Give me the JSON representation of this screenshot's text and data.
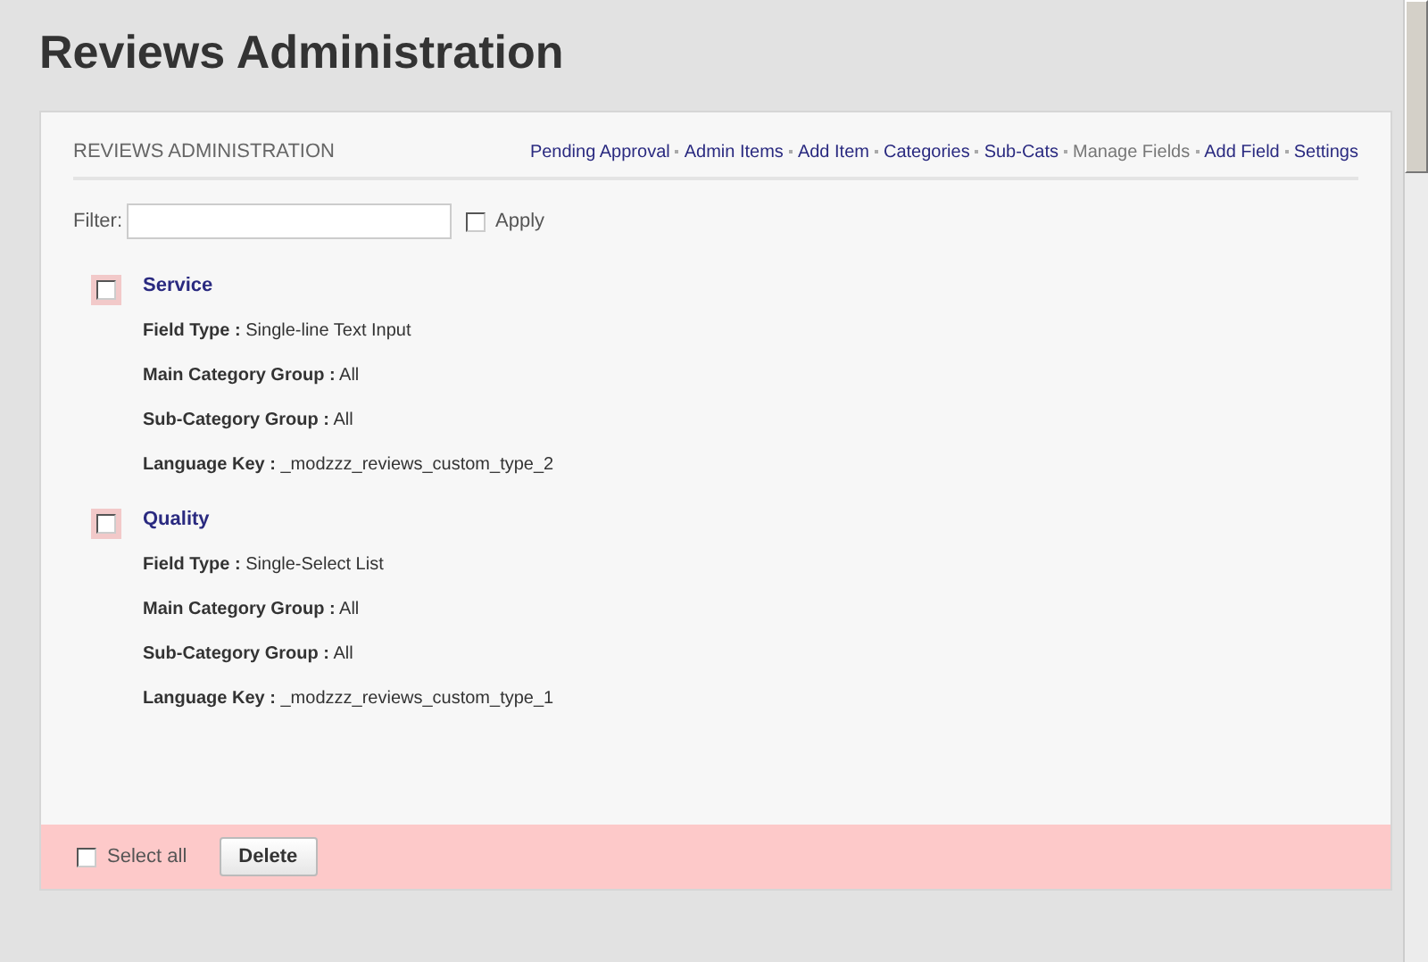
{
  "page_title": "Reviews Administration",
  "panel": {
    "title": "REVIEWS ADMINISTRATION",
    "nav": [
      {
        "label": "Pending Approval",
        "selected": false
      },
      {
        "label": "Admin Items",
        "selected": false
      },
      {
        "label": "Add Item",
        "selected": false
      },
      {
        "label": "Categories",
        "selected": false
      },
      {
        "label": "Sub-Cats",
        "selected": false
      },
      {
        "label": "Manage Fields",
        "selected": true
      },
      {
        "label": "Add Field",
        "selected": false
      },
      {
        "label": "Settings",
        "selected": false
      }
    ],
    "filter": {
      "label": "Filter:",
      "apply_label": "Apply",
      "apply_checked": false
    },
    "fields": [
      {
        "name": "Service",
        "checked": false,
        "properties": [
          {
            "label": "Field Type :",
            "value": "Single-line Text Input"
          },
          {
            "label": "Main Category Group :",
            "value": "All"
          },
          {
            "label": "Sub-Category Group :",
            "value": "All"
          },
          {
            "label": "Language Key :",
            "value": "_modzzz_reviews_custom_type_2"
          }
        ]
      },
      {
        "name": "Quality",
        "checked": false,
        "properties": [
          {
            "label": "Field Type :",
            "value": "Single-Select List"
          },
          {
            "label": "Main Category Group :",
            "value": "All"
          },
          {
            "label": "Sub-Category Group :",
            "value": "All"
          },
          {
            "label": "Language Key :",
            "value": "_modzzz_reviews_custom_type_1"
          }
        ]
      }
    ],
    "footer": {
      "select_all_label": "Select all",
      "select_all_checked": false,
      "delete_button": "Delete"
    }
  }
}
